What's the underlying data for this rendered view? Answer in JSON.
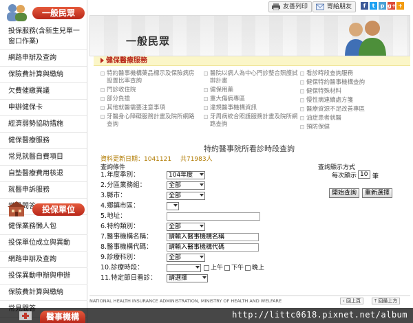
{
  "sidebar": {
    "section1_title": "一般民眾",
    "items1": [
      "投保服務(含新生兒單一窗口作業)",
      "網路申辦及查詢",
      "保險費計算與繳納",
      "欠費催繳異議",
      "申辦健保卡",
      "經濟弱勢協助措施",
      "健保醫療服務",
      "常見就醫自費項目",
      "自墊醫療費用核退",
      "就醫申訴服務",
      "常見問答"
    ],
    "section2_title": "投保單位",
    "items2": [
      "健保業務懶人包",
      "投保單位成立與異動",
      "網路申辦及查詢",
      "投保異動申辦與申辦",
      "保險費計算與繳納",
      "常見問答"
    ],
    "section3_title": "醫事機構"
  },
  "topbar": {
    "print": "友善列印",
    "share": "寄給朋友",
    "social": [
      "f",
      "t",
      "p",
      "g+",
      "+"
    ],
    "social_colors": [
      "#3b5998",
      "#1da1f2",
      "#4aa0d5",
      "#dd4b39",
      "#f39c12"
    ]
  },
  "banner": {
    "title": "一般民眾"
  },
  "service": {
    "title": "健保醫療服務",
    "col1": [
      "特約醫事機構藥品標示及保險病房設置比率查詢",
      "門診收住院",
      "部分負擔",
      "其他就醫需要注意事項",
      "牙醫身心障礙服務計畫及院所網路查詢"
    ],
    "col2": [
      "醫院以病人為中心門診整合照護試辦計畫",
      "健保用藥",
      "重大傷病專區",
      "違規醫事機構資訊",
      "牙周病統合照護服務計畫及院所網路查詢"
    ],
    "col3": [
      "看診時段查詢服務",
      "健保特約醫事機構查詢",
      "健保特殊材料",
      "慢性病連續處方箋",
      "醫療資源不足改善專區",
      "油症患者就醫",
      "預防保健"
    ]
  },
  "form": {
    "title": "特約醫事院所看診時段查詢",
    "update_label": "資料更新日期：1041121",
    "count_label": "共71983人",
    "conditions_label": "查詢條件",
    "fields": [
      {
        "label": "1.年度季別：",
        "value": "104年度"
      },
      {
        "label": "2.分區業務組：",
        "value": "全部"
      },
      {
        "label": "3.縣市：",
        "value": "全部"
      },
      {
        "label": "4.鄉鎮市區：",
        "value": ""
      },
      {
        "label": "5.地址：",
        "value": ""
      },
      {
        "label": "6.特約類別：",
        "value": "全部"
      },
      {
        "label": "7.醫事機構名稱：",
        "value": "請輸入醫事機構名稱"
      },
      {
        "label": "8.醫事機構代碼：",
        "value": "請輸入醫事機構代碼"
      },
      {
        "label": "9.診療科別：",
        "value": "全部"
      },
      {
        "label": "10.診療時段：",
        "value": ""
      },
      {
        "label": "11.特定節日看診：",
        "value": "請選擇"
      }
    ],
    "time_slots": [
      "上午",
      "下午",
      "晚上"
    ],
    "display_label": "查詢顯示方式",
    "per_page_label": "每次顯示",
    "per_page_value": "10",
    "per_page_unit": "筆",
    "search_button": "開始查詢",
    "reset_button": "重新選擇"
  },
  "footer": {
    "text": "NATIONAL HEALTH INSURANCE ADMINISTRATION, MINISTRY OF HEALTH AND WELFARE",
    "back": "回上頁",
    "top": "回最上方"
  },
  "watermark": "http://littc0618.pixnet.net/album"
}
